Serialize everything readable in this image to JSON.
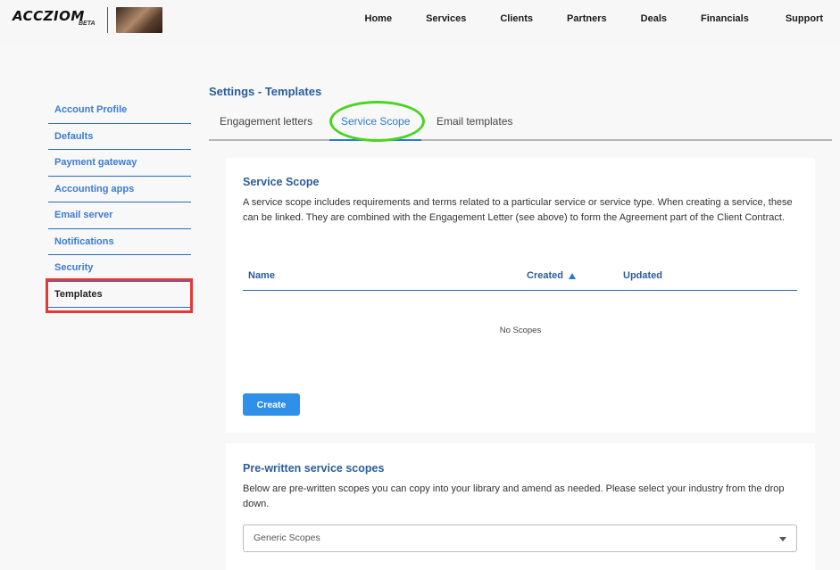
{
  "header": {
    "logo_text": "ACCZIOM",
    "logo_badge": "BETA",
    "nav": [
      "Home",
      "Services",
      "Clients",
      "Partners",
      "Deals",
      "Financials",
      "Support"
    ]
  },
  "sidebar": {
    "items": [
      {
        "label": "Account Profile"
      },
      {
        "label": "Defaults"
      },
      {
        "label": "Payment gateway"
      },
      {
        "label": "Accounting apps"
      },
      {
        "label": "Email server"
      },
      {
        "label": "Notifications"
      },
      {
        "label": "Security"
      },
      {
        "label": "Templates"
      }
    ],
    "active": "Templates"
  },
  "main": {
    "page_title": "Settings - Templates",
    "tabs": [
      "Engagement letters",
      "Service Scope",
      "Email templates"
    ],
    "active_tab": "Service Scope",
    "service_scope": {
      "title": "Service Scope",
      "description": "A service scope includes requirements and terms related to a particular service or service type. When creating a service, these can be linked. They are combined with the Engagement Letter (see above) to form the Agreement part of the Client Contract.",
      "columns": [
        "Name",
        "Created",
        "Updated"
      ],
      "sorted_column": "Created",
      "sort_direction": "ascending",
      "empty_message": "No Scopes",
      "create_label": "Create"
    },
    "prewritten": {
      "title": "Pre-written service scopes",
      "description": "Below are pre-written scopes you can copy into your library and amend as needed. Please select your industry from the drop down.",
      "select_value": "Generic Scopes"
    }
  },
  "colors": {
    "accent": "#2a7bd3",
    "heading": "#2a5d9a",
    "button": "#2e90e8",
    "annotation_red": "#e53935",
    "annotation_green": "#4ad41f"
  }
}
